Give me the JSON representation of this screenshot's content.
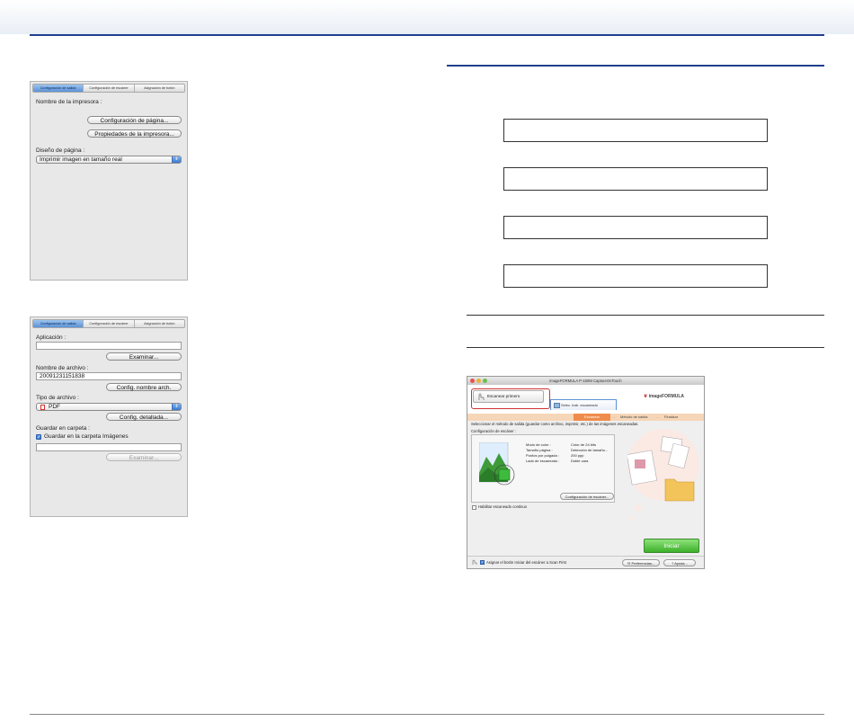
{
  "panel1": {
    "tabs": [
      "Configuración de salida",
      "Configuración de escáner",
      "Asignación de botón"
    ],
    "printer_name_label": "Nombre de la impresora :",
    "page_setup_button": "Configuración de página...",
    "printer_properties_button": "Propiedades de la impresora...",
    "page_layout_label": "Diseño de página :",
    "page_layout_value": "Imprimir imagen en tamaño real"
  },
  "panel2": {
    "tabs": [
      "Configuración de salida",
      "Configuración de escáner",
      "Asignación de botón"
    ],
    "application_label": "Aplicación :",
    "application_value": "",
    "browse_button": "Examinar...",
    "file_name_label": "Nombre de archivo :",
    "file_name_value": "20091231151838",
    "file_name_settings_button": "Config. nombre arch.",
    "file_type_label": "Tipo de archivo :",
    "file_type_value": "PDF",
    "detailed_settings_button": "Config. detallada...",
    "save_folder_label": "Guardar en carpeta :",
    "save_in_images_checkbox": "Guardar en la carpeta Imágenes",
    "folder_path_value": "",
    "browse_button_disabled": "Examinar..."
  },
  "window": {
    "title": "imageFORMULA P-150M CaptureOnTouch",
    "scan_first_label": "Escanear primero",
    "scan_job_tab": "Selec. trab. escaneado",
    "logo_text": "imageFORMULA",
    "steps": [
      "Escanear",
      "Método de salida",
      "Finalizar"
    ],
    "instruction": "Seleccionar el método de salida (guardar como archivo, imprimir, etc.) de las imágenes escaneadas.",
    "scanner_settings_group": "Configuración de escáner :",
    "settings": [
      {
        "key": "Modo de color :",
        "value": "Color de 24 bits"
      },
      {
        "key": "Tamaño página :",
        "value": "Detección de tamaño..."
      },
      {
        "key": "Puntos por pulgada :",
        "value": "200 ppp"
      },
      {
        "key": "Lado de escaneado :",
        "value": "Doble cara"
      }
    ],
    "scanner_settings_button": "Configuración de escáner...",
    "continuous_scan_checkbox": "Habilitar escaneado continuo",
    "start_button": "Iniciar",
    "assign_button_checkbox": "Asignar el botón Iniciar del escáner a Scan First",
    "preferences_button": "Preferencias...",
    "help_button": "Ayuda..."
  },
  "colors": {
    "rule_blue": "#1f3f8f",
    "step_orange": "#ef8c4b",
    "start_green": "#3db02b",
    "highlight_red": "#cc3333"
  }
}
